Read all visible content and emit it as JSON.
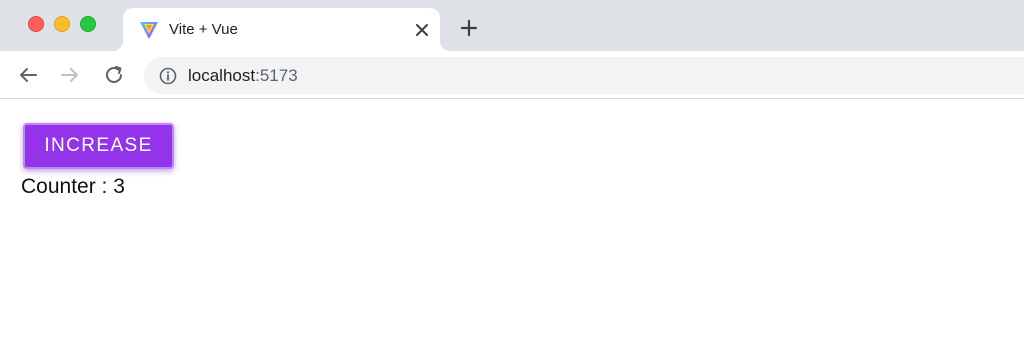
{
  "browser": {
    "tab": {
      "title": "Vite + Vue",
      "favicon": "vite-logo-icon"
    },
    "address": {
      "host": "localhost",
      "port": ":5173"
    }
  },
  "page": {
    "button_label": "INCREASE",
    "counter_label": "Counter : ",
    "counter_value": "3"
  },
  "colors": {
    "button_bg": "#9333ea",
    "button_border": "#c084fc"
  }
}
